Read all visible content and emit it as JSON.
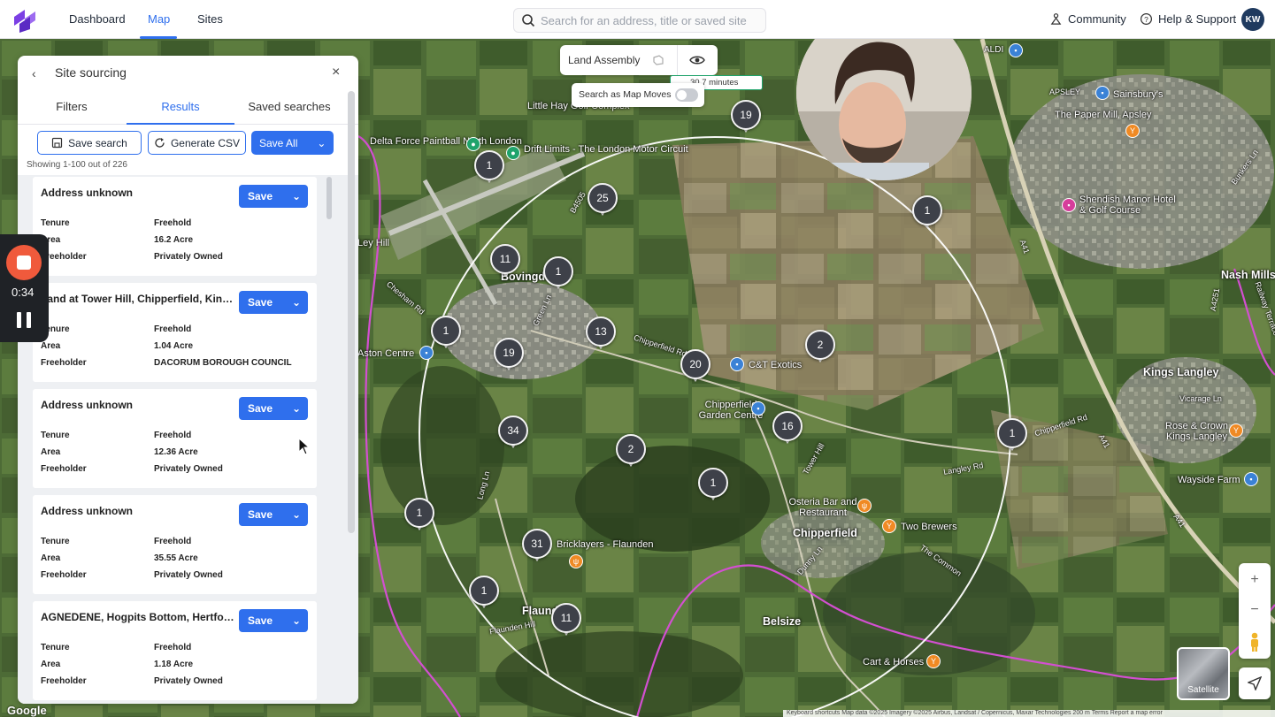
{
  "nav": {
    "dashboard": "Dashboard",
    "map": "Map",
    "sites": "Sites",
    "search_placeholder": "Search for an address, title or saved site",
    "community": "Community",
    "help": "Help & Support",
    "avatar_initials": "KW"
  },
  "panel": {
    "title": "Site sourcing",
    "tabs": [
      "Filters",
      "Results",
      "Saved searches"
    ],
    "buttons": {
      "save_search": "Save search",
      "generate_csv": "Generate CSV",
      "save_all": "Save All"
    },
    "showing": "Showing 1-100 out of 226",
    "field_labels": {
      "tenure": "Tenure",
      "area": "Area",
      "freeholder": "Freeholder"
    },
    "save_label": "Save",
    "results": [
      {
        "title": "Address unknown",
        "tenure": "Freehold",
        "area": "16.2 Acre",
        "freeholder": "Privately Owned"
      },
      {
        "title": "Land at Tower Hill, Chipperfield, Kings...",
        "tenure": "Freehold",
        "area": "1.04 Acre",
        "freeholder": "DACORUM BOROUGH COUNCIL"
      },
      {
        "title": "Address unknown",
        "tenure": "Freehold",
        "area": "12.36 Acre",
        "freeholder": "Privately Owned"
      },
      {
        "title": "Address unknown",
        "tenure": "Freehold",
        "area": "35.55 Acre",
        "freeholder": "Privately Owned"
      },
      {
        "title": "AGNEDENE, Hogpits Bottom, Hertford...",
        "tenure": "Freehold",
        "area": "1.18 Acre",
        "freeholder": "Privately Owned"
      }
    ]
  },
  "recorder": {
    "time": "0:34"
  },
  "map_controls": {
    "land_assembly": "Land Assembly",
    "search_as_map_moves": "Search as Map Moves",
    "travel_time": "30.7 minutes",
    "zoom_in": "+",
    "zoom_out": "−",
    "satellite": "Satellite",
    "attribution": "Keyboard shortcuts   Map data ©2025 Imagery ©2025 Airbus, Landsat / Copernicus, Maxar Technologies   200 m   Terms   Report a map error",
    "google": "Google"
  },
  "clusters": [
    "19",
    "1",
    "25",
    "11",
    "1",
    "1",
    "19",
    "13",
    "20",
    "2",
    "1",
    "34",
    "2",
    "16",
    "1",
    "1",
    "31",
    "1",
    "11",
    "1"
  ],
  "places": {
    "delta_force": "Delta Force Paintball North London",
    "drift_limits": "Drift Limits - The London Motor Circuit",
    "little_hay": "Little Hay Golf Complex",
    "bovingdon": "Bovingdon",
    "aston": "Aston Centre",
    "ley_hill": "Ley Hill",
    "ct_exotics": "C&T Exotics",
    "chipperfield_gc": "Chipperfield Garden Centre",
    "chipperfield": "Chipperfield",
    "osteria": "Osteria Bar and Restaurant",
    "two_brewers": "Two Brewers",
    "bricklayers": "Bricklayers - Flaunden",
    "flaunden": "Flaunden",
    "belsize": "Belsize",
    "cart_horses": "Cart & Horses",
    "kings_langley": "Kings Langley",
    "rose_crown": "Rose & Crown Kings Langley",
    "wayside": "Wayside Farm",
    "nash_mills": "Nash Mills",
    "shendish": "Shendish Manor Hotel & Golf Course",
    "paper_mill": "The Paper Mill, Apsley",
    "sainsburys": "Sainsbury's",
    "apsley": "APSLEY",
    "aldi": "ALDI",
    "chipperfield_rd": "Chipperfield Rd",
    "langley_rd": "Langley Rd",
    "tower_hill": "Tower Hill",
    "the_common": "The Common",
    "dunny_ln": "Dunny Ln",
    "flaunden_hill": "Flaunden Hill",
    "long_ln": "Long Ln",
    "green_ln": "Green Ln",
    "chesham_rd": "Chesham Rd",
    "a41": "A41",
    "b4505": "B4505",
    "vicarage_ln": "Vicarage Ln",
    "a4251": "A4251",
    "bunkers_ln": "Bunkers Ln",
    "railway_terrace": "Railway Terrace"
  }
}
